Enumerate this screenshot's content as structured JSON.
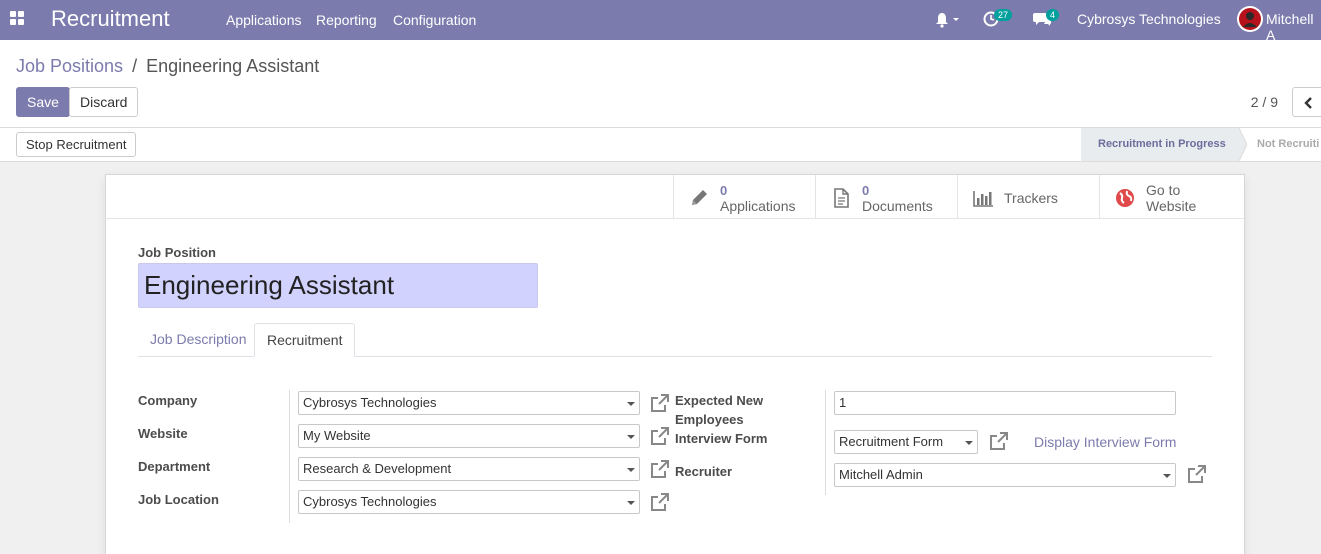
{
  "navbar": {
    "app_title": "Recruitment",
    "menus": [
      "Applications",
      "Reporting",
      "Configuration"
    ],
    "activity_count": "27",
    "message_count": "4",
    "company": "Cybrosys Technologies",
    "user": "Mitchell A"
  },
  "control": {
    "breadcrumb_parent": "Job Positions",
    "breadcrumb_sep": "/",
    "breadcrumb_current": "Engineering Assistant",
    "save_label": "Save",
    "discard_label": "Discard",
    "pager": "2 / 9"
  },
  "statusbar": {
    "action_label": "Stop Recruitment",
    "stage_active": "Recruitment in Progress",
    "stage_next": "Not Recruiti"
  },
  "smart_buttons": {
    "applications_count": "0",
    "applications_label": "Applications",
    "documents_count": "0",
    "documents_label": "Documents",
    "trackers_label": "Trackers",
    "website_line1": "Go to",
    "website_line2": "Website"
  },
  "form": {
    "job_position_label": "Job Position",
    "job_position_value": "Engineering Assistant",
    "tabs": [
      "Job Description",
      "Recruitment"
    ],
    "company_label": "Company",
    "company_value": "Cybrosys Technologies",
    "website_label": "Website",
    "website_value": "My Website",
    "department_label": "Department",
    "department_value": "Research & Development",
    "job_location_label": "Job Location",
    "job_location_value": "Cybrosys Technologies",
    "expected_label_1": "Expected New",
    "expected_label_2": "Employees",
    "expected_value": "1",
    "interview_form_label": "Interview Form",
    "interview_form_value": "Recruitment Form",
    "display_interview_form": "Display Interview Form",
    "recruiter_label": "Recruiter",
    "recruiter_value": "Mitchell Admin"
  },
  "colors": {
    "brand": "#7c7bad",
    "badge": "#00a09d",
    "name_field_bg": "#d2d2ff"
  }
}
